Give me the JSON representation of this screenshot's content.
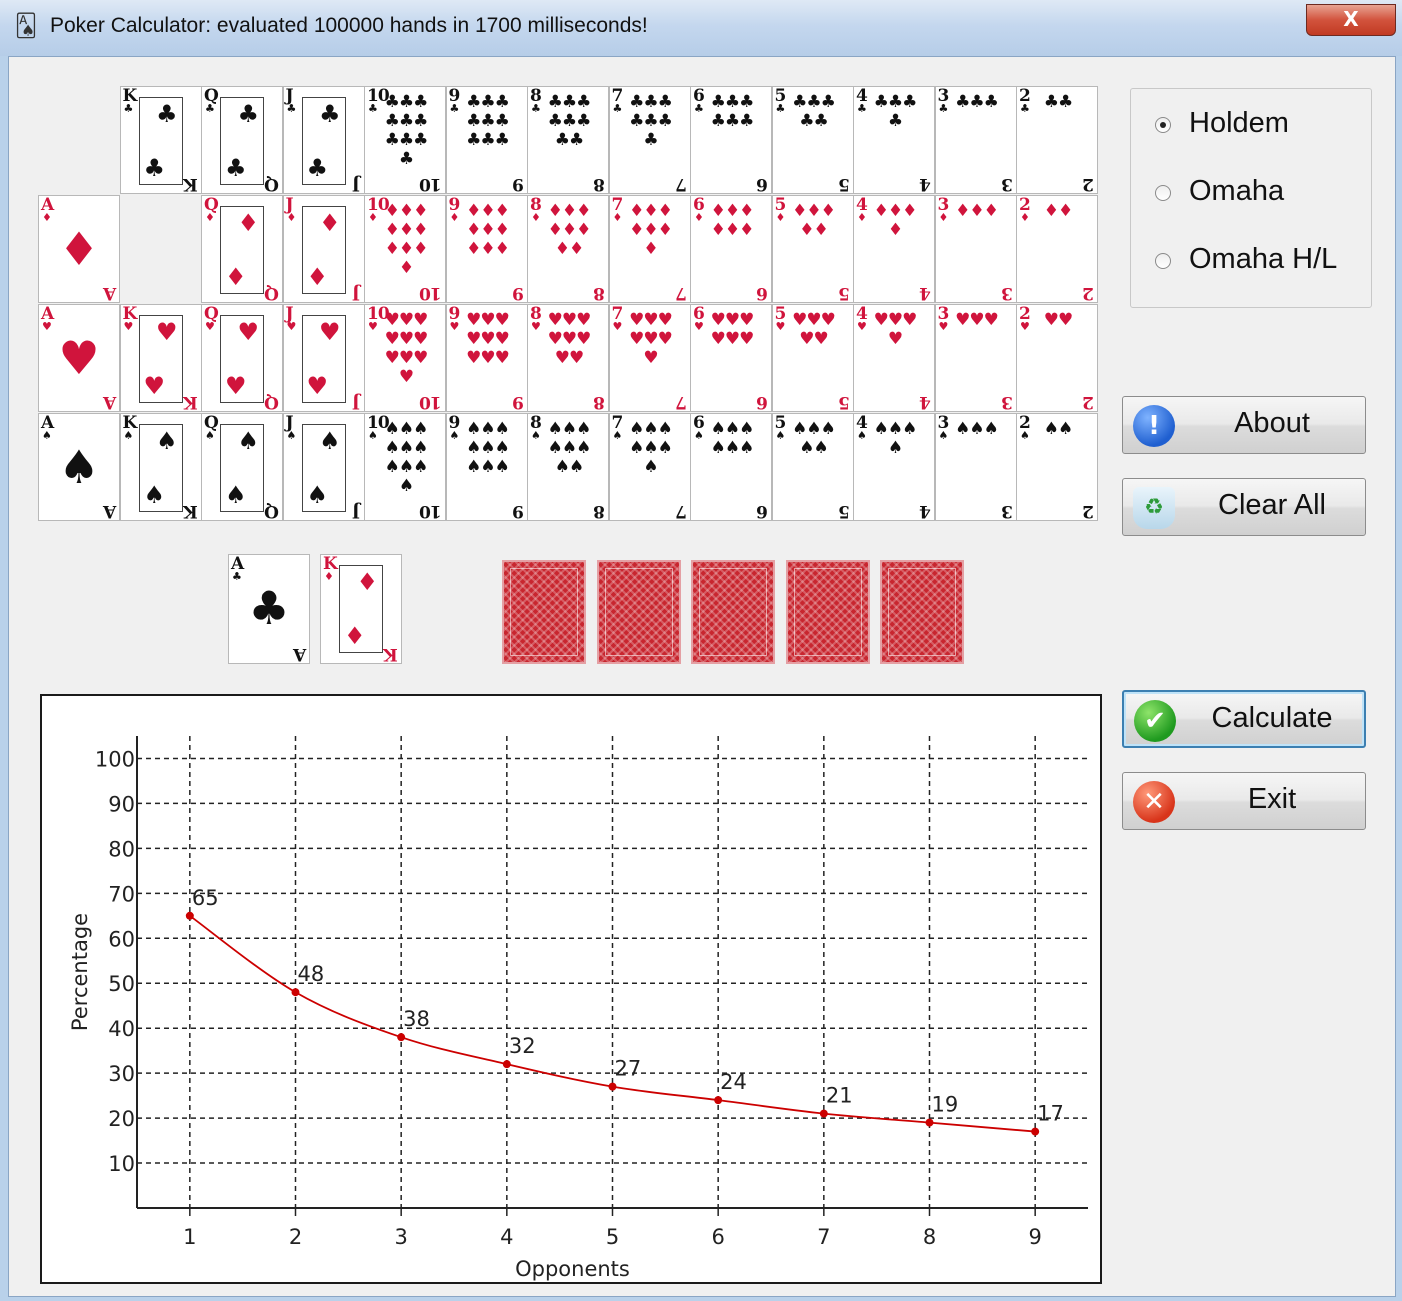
{
  "window": {
    "title": "Poker Calculator: evaluated 100000 hands in 1700 milliseconds!",
    "close_label": "X"
  },
  "deck": {
    "ranks": [
      "A",
      "K",
      "Q",
      "J",
      "10",
      "9",
      "8",
      "7",
      "6",
      "5",
      "4",
      "3",
      "2"
    ],
    "suits": [
      {
        "name": "clubs",
        "symbol": "♣",
        "color": "#111111"
      },
      {
        "name": "diamonds",
        "symbol": "♦",
        "color": "#d0143c"
      },
      {
        "name": "hearts",
        "symbol": "♥",
        "color": "#d0143c"
      },
      {
        "name": "spades",
        "symbol": "♠",
        "color": "#111111"
      }
    ],
    "removed": [
      "A-clubs",
      "K-diamonds"
    ]
  },
  "hand": [
    {
      "rank": "A",
      "suit": "clubs"
    },
    {
      "rank": "K",
      "suit": "diamonds"
    }
  ],
  "board": {
    "face_down_count": 5
  },
  "game_type": {
    "options": [
      {
        "label": "Holdem",
        "selected": true
      },
      {
        "label": "Omaha",
        "selected": false
      },
      {
        "label": "Omaha H/L",
        "selected": false
      }
    ]
  },
  "buttons": {
    "about": {
      "label": "About",
      "icon": "info-icon"
    },
    "clear_all": {
      "label": "Clear All",
      "icon": "recycle-bin-icon"
    },
    "calculate": {
      "label": "Calculate",
      "icon": "checkmark-icon"
    },
    "exit": {
      "label": "Exit",
      "icon": "close-icon"
    }
  },
  "chart_data": {
    "type": "line",
    "x": [
      1,
      2,
      3,
      4,
      5,
      6,
      7,
      8,
      9
    ],
    "values": [
      65,
      48,
      38,
      32,
      27,
      24,
      21,
      19,
      17
    ],
    "data_labels": [
      "65",
      "48",
      "38",
      "32",
      "27",
      "24",
      "21",
      "19",
      "17"
    ],
    "xlabel": "Opponents",
    "ylabel": "Percentage",
    "xticks": [
      "1",
      "2",
      "3",
      "4",
      "5",
      "6",
      "7",
      "8",
      "9"
    ],
    "yticks": [
      "10",
      "20",
      "30",
      "40",
      "50",
      "60",
      "70",
      "80",
      "90",
      "100"
    ],
    "xlim": [
      0.5,
      9.5
    ],
    "ylim": [
      0,
      105
    ],
    "grid": true,
    "line_color": "#cc0000"
  }
}
